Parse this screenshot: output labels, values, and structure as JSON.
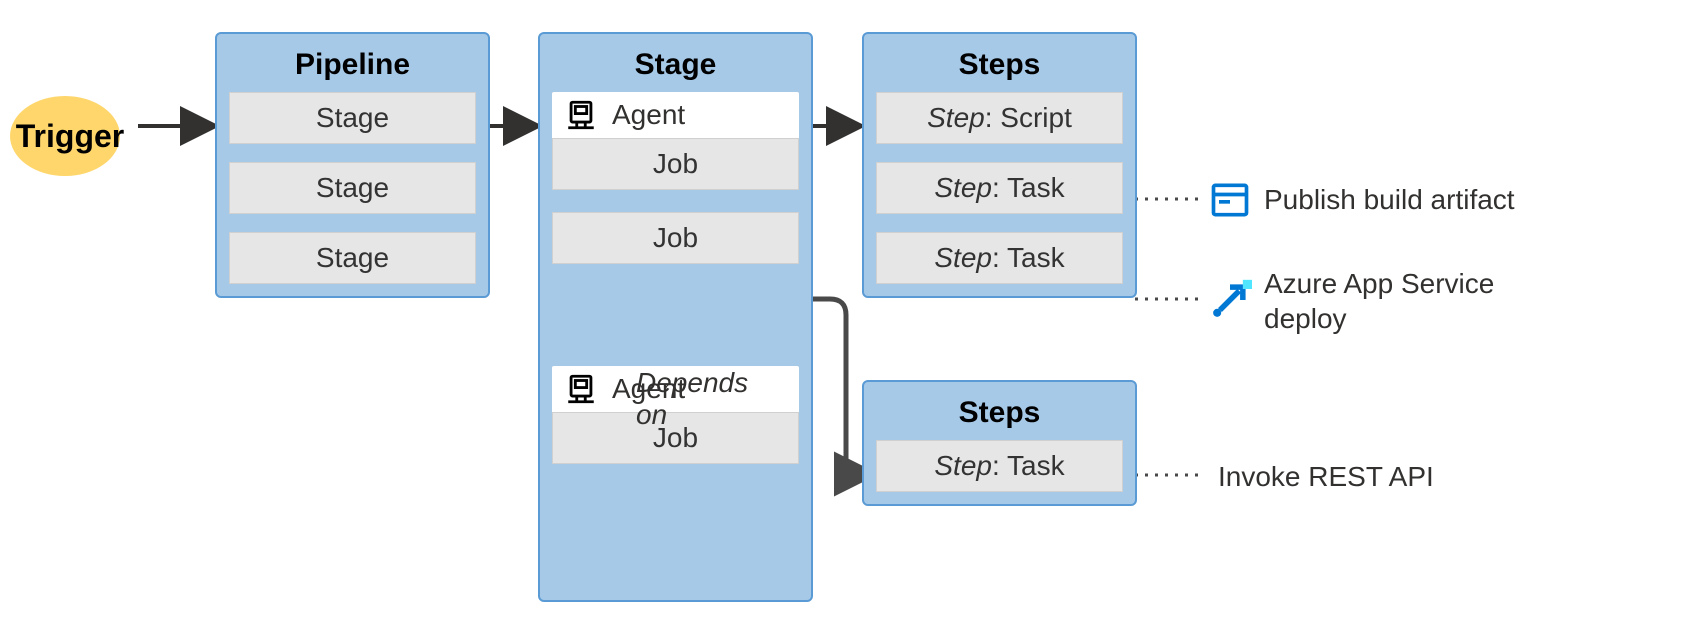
{
  "trigger": {
    "label": "Trigger"
  },
  "pipeline_panel": {
    "title": "Pipeline",
    "items": [
      "Stage",
      "Stage",
      "Stage"
    ]
  },
  "stage_panel": {
    "title": "Stage",
    "agent1_label": "Agent",
    "job1_label": "Job",
    "job2_label": "Job",
    "depends_label": "Depends on",
    "agent2_label": "Agent",
    "job3_label": "Job"
  },
  "steps_panel_1": {
    "title": "Steps",
    "items": [
      {
        "prefix": "Step",
        "suffix": ": Script"
      },
      {
        "prefix": "Step",
        "suffix": ": Task"
      },
      {
        "prefix": "Step",
        "suffix": ": Task"
      }
    ]
  },
  "steps_panel_2": {
    "title": "Steps",
    "items": [
      {
        "prefix": "Step",
        "suffix": ": Task"
      }
    ]
  },
  "annotations": {
    "publish": "Publish build artifact",
    "app_service": "Azure App Service deploy",
    "invoke_rest": "Invoke REST API"
  }
}
